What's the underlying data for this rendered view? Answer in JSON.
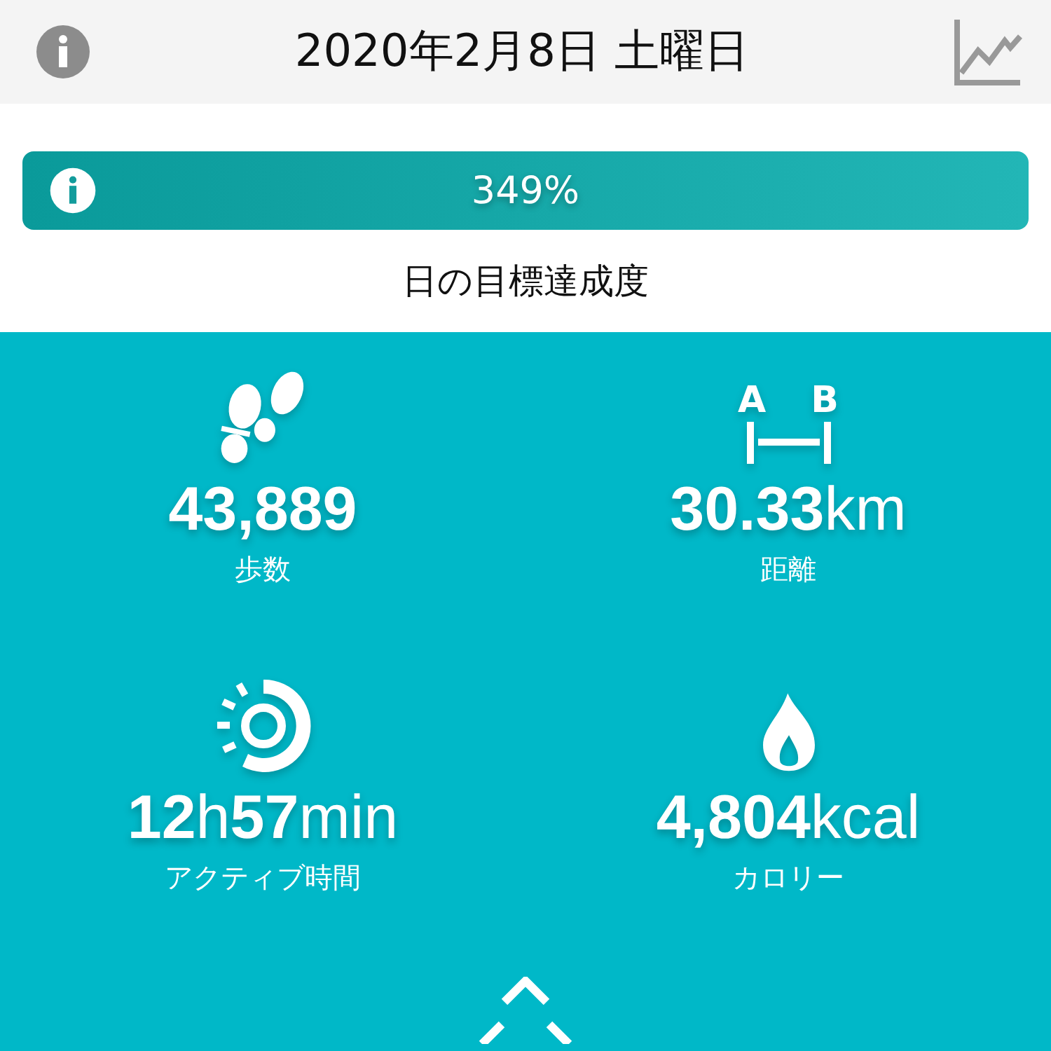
{
  "header": {
    "title": "2020年2月8日 土曜日"
  },
  "goal": {
    "reading": "349%",
    "label": "日の目標達成度"
  },
  "stats": [
    {
      "kind": "steps",
      "value": "**43,889**",
      "label": "歩数"
    },
    {
      "kind": "distance",
      "value": "**30.33**km",
      "label": "距離"
    },
    {
      "kind": "active",
      "value": "**12**h**57**min",
      "label": "アクティブ時間"
    },
    {
      "kind": "calories",
      "value": "**4,804**kcal",
      "label": "カロリー"
    }
  ],
  "distance_icon_letters": [
    "A",
    "B"
  ]
}
